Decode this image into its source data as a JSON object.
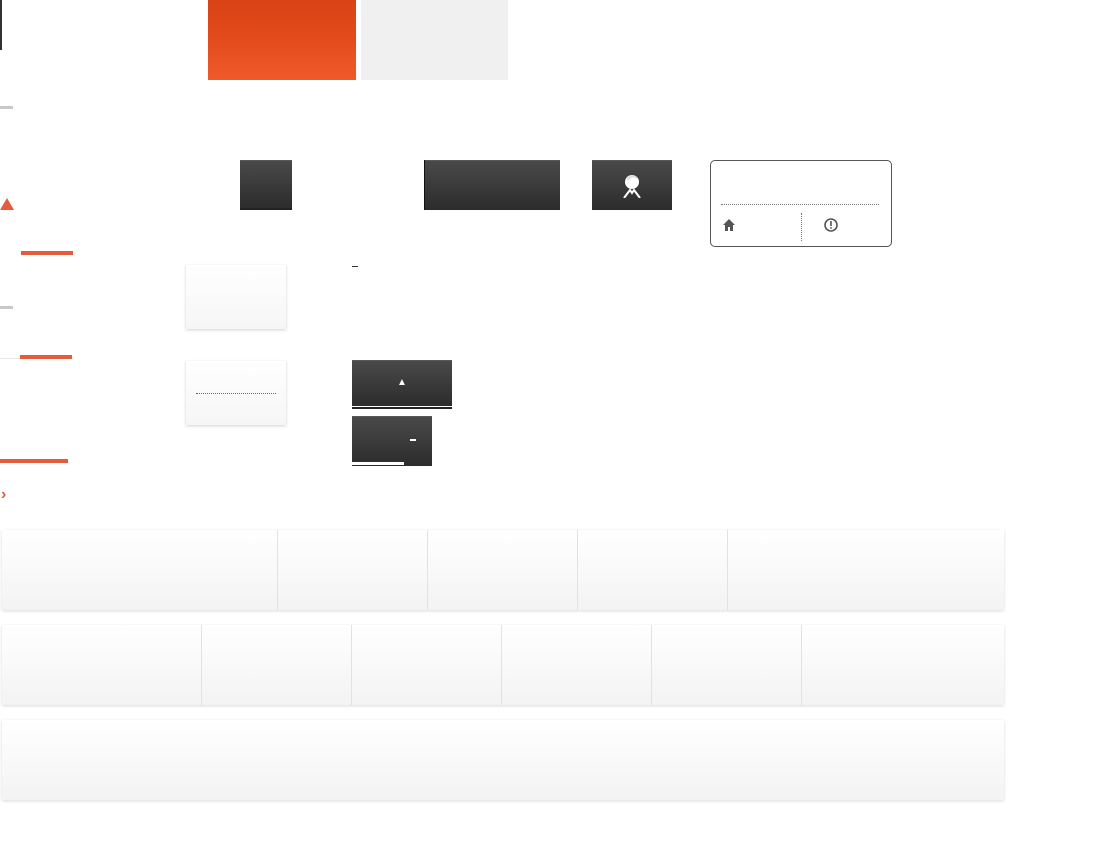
{
  "colors": {
    "accent": "#e55b3c",
    "accent_dark": "#d84315",
    "button_dark": "#333333",
    "panel_light": "#f6f6f6"
  },
  "icons": {
    "avatar": "user-avatar-icon",
    "home": "home-icon",
    "info": "info-icon",
    "scroll_up": "triangle-up-icon",
    "chevron": "chevron-right-icon"
  },
  "chevron_glyph": "›",
  "scroll_up_glyph": "▲",
  "rows": [
    {
      "cells": 5
    },
    {
      "cells": 6
    },
    {
      "cells": 1
    }
  ]
}
